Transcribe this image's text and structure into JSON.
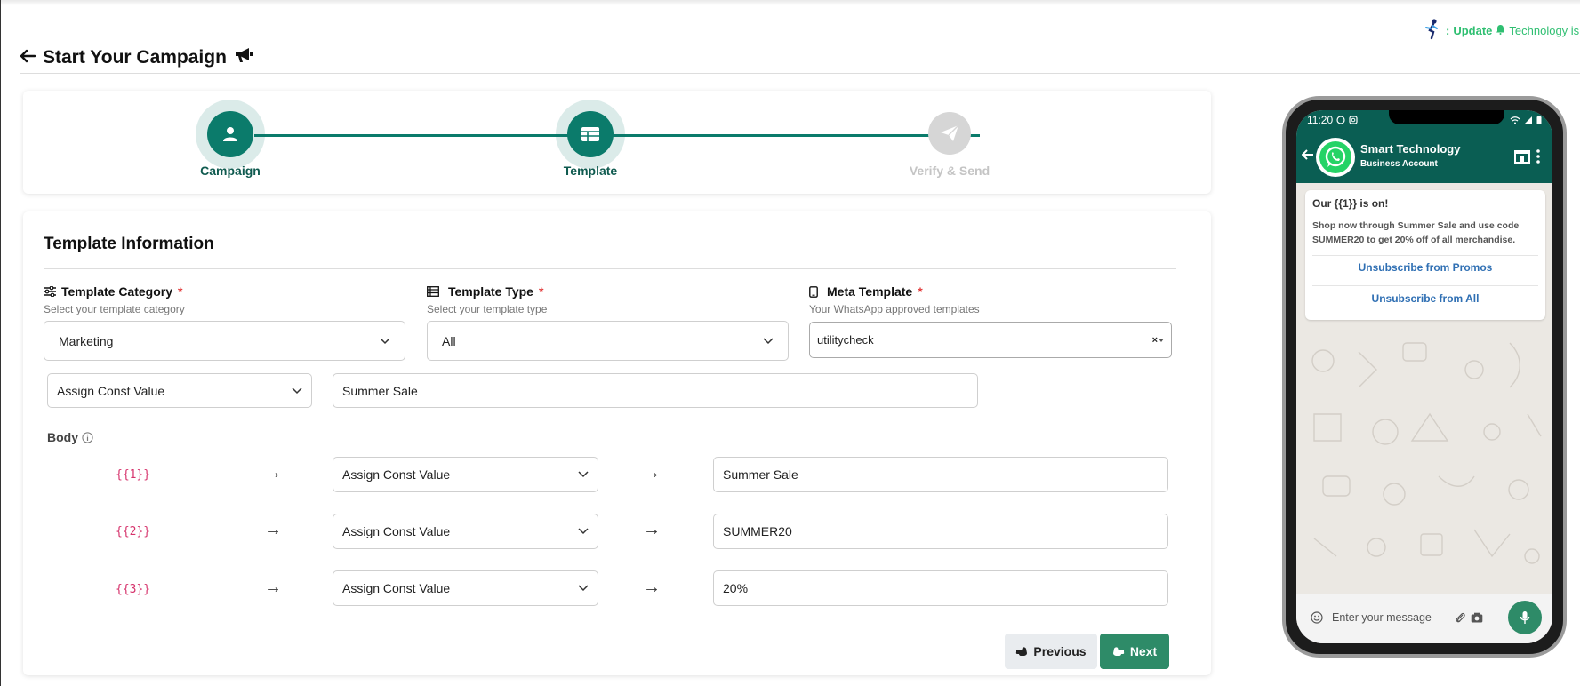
{
  "ticker": {
    "prefix": ":",
    "bold": "Update",
    "text": "Technology is"
  },
  "page": {
    "title": "Start Your Campaign"
  },
  "stepper": {
    "steps": [
      {
        "label": "Campaign",
        "state": "done"
      },
      {
        "label": "Template",
        "state": "active"
      },
      {
        "label": "Verify & Send",
        "state": "pending"
      }
    ]
  },
  "form": {
    "title": "Template Information",
    "category": {
      "label": "Template Category",
      "required": "*",
      "hint": "Select your template category",
      "value": "Marketing"
    },
    "type": {
      "label": "Template Type",
      "required": "*",
      "hint": "Select your template type",
      "value": "All"
    },
    "meta": {
      "label": "Meta Template",
      "required": "*",
      "hint": "Your WhatsApp approved templates",
      "value": "utilitycheck"
    },
    "header_row": {
      "select": "Assign Const Value",
      "value": "Summer Sale"
    },
    "body_label": "Body",
    "body_rows": [
      {
        "var": "{{1}}",
        "select": "Assign Const Value",
        "value": "Summer Sale"
      },
      {
        "var": "{{2}}",
        "select": "Assign Const Value",
        "value": "SUMMER20"
      },
      {
        "var": "{{3}}",
        "select": "Assign Const Value",
        "value": "20%"
      }
    ],
    "prev_label": "Previous",
    "next_label": "Next"
  },
  "phone": {
    "time": "11:20",
    "contact_name": "Smart Technology",
    "contact_sub": "Business Account",
    "message_title": "Our {{1}} is on!",
    "message_body": "Shop now through Summer Sale and use code SUMMER20 to get 20% off of all merchandise.",
    "buttons": [
      "Unsubscribe from Promos",
      "Unsubscribe from All"
    ],
    "input_placeholder": "Enter your message"
  },
  "colors": {
    "primary": "#0b7b6b",
    "next_button": "#2e8b68",
    "required": "#e23a3a",
    "variable": "#d6336c",
    "whatsapp_header": "#0a5e53"
  }
}
